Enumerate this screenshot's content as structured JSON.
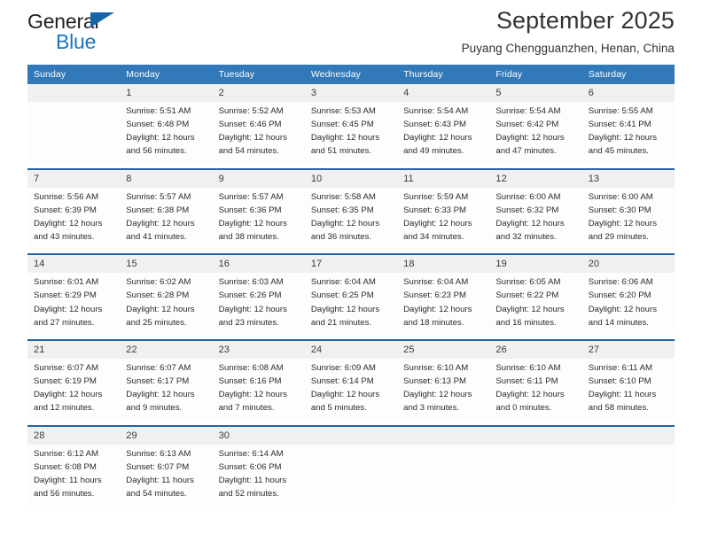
{
  "brand": {
    "name_part1": "General",
    "name_part2": "Blue",
    "triangle_color": "#1565a8",
    "blue_color": "#1b76bd"
  },
  "header": {
    "title": "September 2025",
    "subtitle": "Puyang Chengguanzhen, Henan, China",
    "header_bg": "#3179b9"
  },
  "weekdays": [
    "Sunday",
    "Monday",
    "Tuesday",
    "Wednesday",
    "Thursday",
    "Friday",
    "Saturday"
  ],
  "weeks": [
    {
      "days": [
        {
          "num": "",
          "sunrise": "",
          "sunset": "",
          "daylight1": "",
          "daylight2": ""
        },
        {
          "num": "1",
          "sunrise": "Sunrise: 5:51 AM",
          "sunset": "Sunset: 6:48 PM",
          "daylight1": "Daylight: 12 hours",
          "daylight2": "and 56 minutes."
        },
        {
          "num": "2",
          "sunrise": "Sunrise: 5:52 AM",
          "sunset": "Sunset: 6:46 PM",
          "daylight1": "Daylight: 12 hours",
          "daylight2": "and 54 minutes."
        },
        {
          "num": "3",
          "sunrise": "Sunrise: 5:53 AM",
          "sunset": "Sunset: 6:45 PM",
          "daylight1": "Daylight: 12 hours",
          "daylight2": "and 51 minutes."
        },
        {
          "num": "4",
          "sunrise": "Sunrise: 5:54 AM",
          "sunset": "Sunset: 6:43 PM",
          "daylight1": "Daylight: 12 hours",
          "daylight2": "and 49 minutes."
        },
        {
          "num": "5",
          "sunrise": "Sunrise: 5:54 AM",
          "sunset": "Sunset: 6:42 PM",
          "daylight1": "Daylight: 12 hours",
          "daylight2": "and 47 minutes."
        },
        {
          "num": "6",
          "sunrise": "Sunrise: 5:55 AM",
          "sunset": "Sunset: 6:41 PM",
          "daylight1": "Daylight: 12 hours",
          "daylight2": "and 45 minutes."
        }
      ]
    },
    {
      "days": [
        {
          "num": "7",
          "sunrise": "Sunrise: 5:56 AM",
          "sunset": "Sunset: 6:39 PM",
          "daylight1": "Daylight: 12 hours",
          "daylight2": "and 43 minutes."
        },
        {
          "num": "8",
          "sunrise": "Sunrise: 5:57 AM",
          "sunset": "Sunset: 6:38 PM",
          "daylight1": "Daylight: 12 hours",
          "daylight2": "and 41 minutes."
        },
        {
          "num": "9",
          "sunrise": "Sunrise: 5:57 AM",
          "sunset": "Sunset: 6:36 PM",
          "daylight1": "Daylight: 12 hours",
          "daylight2": "and 38 minutes."
        },
        {
          "num": "10",
          "sunrise": "Sunrise: 5:58 AM",
          "sunset": "Sunset: 6:35 PM",
          "daylight1": "Daylight: 12 hours",
          "daylight2": "and 36 minutes."
        },
        {
          "num": "11",
          "sunrise": "Sunrise: 5:59 AM",
          "sunset": "Sunset: 6:33 PM",
          "daylight1": "Daylight: 12 hours",
          "daylight2": "and 34 minutes."
        },
        {
          "num": "12",
          "sunrise": "Sunrise: 6:00 AM",
          "sunset": "Sunset: 6:32 PM",
          "daylight1": "Daylight: 12 hours",
          "daylight2": "and 32 minutes."
        },
        {
          "num": "13",
          "sunrise": "Sunrise: 6:00 AM",
          "sunset": "Sunset: 6:30 PM",
          "daylight1": "Daylight: 12 hours",
          "daylight2": "and 29 minutes."
        }
      ]
    },
    {
      "days": [
        {
          "num": "14",
          "sunrise": "Sunrise: 6:01 AM",
          "sunset": "Sunset: 6:29 PM",
          "daylight1": "Daylight: 12 hours",
          "daylight2": "and 27 minutes."
        },
        {
          "num": "15",
          "sunrise": "Sunrise: 6:02 AM",
          "sunset": "Sunset: 6:28 PM",
          "daylight1": "Daylight: 12 hours",
          "daylight2": "and 25 minutes."
        },
        {
          "num": "16",
          "sunrise": "Sunrise: 6:03 AM",
          "sunset": "Sunset: 6:26 PM",
          "daylight1": "Daylight: 12 hours",
          "daylight2": "and 23 minutes."
        },
        {
          "num": "17",
          "sunrise": "Sunrise: 6:04 AM",
          "sunset": "Sunset: 6:25 PM",
          "daylight1": "Daylight: 12 hours",
          "daylight2": "and 21 minutes."
        },
        {
          "num": "18",
          "sunrise": "Sunrise: 6:04 AM",
          "sunset": "Sunset: 6:23 PM",
          "daylight1": "Daylight: 12 hours",
          "daylight2": "and 18 minutes."
        },
        {
          "num": "19",
          "sunrise": "Sunrise: 6:05 AM",
          "sunset": "Sunset: 6:22 PM",
          "daylight1": "Daylight: 12 hours",
          "daylight2": "and 16 minutes."
        },
        {
          "num": "20",
          "sunrise": "Sunrise: 6:06 AM",
          "sunset": "Sunset: 6:20 PM",
          "daylight1": "Daylight: 12 hours",
          "daylight2": "and 14 minutes."
        }
      ]
    },
    {
      "days": [
        {
          "num": "21",
          "sunrise": "Sunrise: 6:07 AM",
          "sunset": "Sunset: 6:19 PM",
          "daylight1": "Daylight: 12 hours",
          "daylight2": "and 12 minutes."
        },
        {
          "num": "22",
          "sunrise": "Sunrise: 6:07 AM",
          "sunset": "Sunset: 6:17 PM",
          "daylight1": "Daylight: 12 hours",
          "daylight2": "and 9 minutes."
        },
        {
          "num": "23",
          "sunrise": "Sunrise: 6:08 AM",
          "sunset": "Sunset: 6:16 PM",
          "daylight1": "Daylight: 12 hours",
          "daylight2": "and 7 minutes."
        },
        {
          "num": "24",
          "sunrise": "Sunrise: 6:09 AM",
          "sunset": "Sunset: 6:14 PM",
          "daylight1": "Daylight: 12 hours",
          "daylight2": "and 5 minutes."
        },
        {
          "num": "25",
          "sunrise": "Sunrise: 6:10 AM",
          "sunset": "Sunset: 6:13 PM",
          "daylight1": "Daylight: 12 hours",
          "daylight2": "and 3 minutes."
        },
        {
          "num": "26",
          "sunrise": "Sunrise: 6:10 AM",
          "sunset": "Sunset: 6:11 PM",
          "daylight1": "Daylight: 12 hours",
          "daylight2": "and 0 minutes."
        },
        {
          "num": "27",
          "sunrise": "Sunrise: 6:11 AM",
          "sunset": "Sunset: 6:10 PM",
          "daylight1": "Daylight: 11 hours",
          "daylight2": "and 58 minutes."
        }
      ]
    },
    {
      "days": [
        {
          "num": "28",
          "sunrise": "Sunrise: 6:12 AM",
          "sunset": "Sunset: 6:08 PM",
          "daylight1": "Daylight: 11 hours",
          "daylight2": "and 56 minutes."
        },
        {
          "num": "29",
          "sunrise": "Sunrise: 6:13 AM",
          "sunset": "Sunset: 6:07 PM",
          "daylight1": "Daylight: 11 hours",
          "daylight2": "and 54 minutes."
        },
        {
          "num": "30",
          "sunrise": "Sunrise: 6:14 AM",
          "sunset": "Sunset: 6:06 PM",
          "daylight1": "Daylight: 11 hours",
          "daylight2": "and 52 minutes."
        },
        {
          "num": "",
          "sunrise": "",
          "sunset": "",
          "daylight1": "",
          "daylight2": ""
        },
        {
          "num": "",
          "sunrise": "",
          "sunset": "",
          "daylight1": "",
          "daylight2": ""
        },
        {
          "num": "",
          "sunrise": "",
          "sunset": "",
          "daylight1": "",
          "daylight2": ""
        },
        {
          "num": "",
          "sunrise": "",
          "sunset": "",
          "daylight1": "",
          "daylight2": ""
        }
      ]
    }
  ]
}
